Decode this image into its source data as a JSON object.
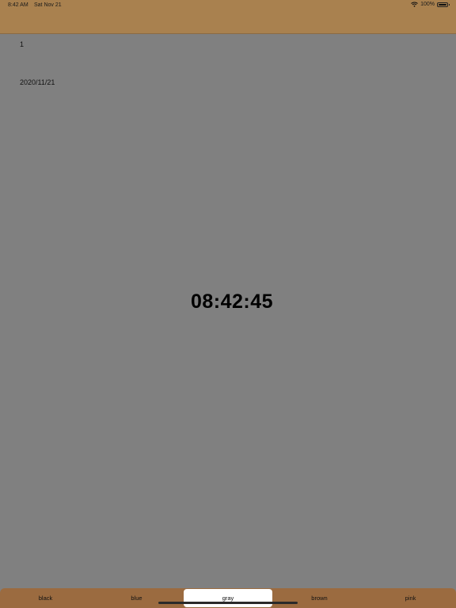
{
  "status_bar": {
    "time": "8:42 AM",
    "date": "Sat Nov 21",
    "battery": "100%"
  },
  "main": {
    "count": "1",
    "date": "2020/11/21",
    "clock": "08:42:45"
  },
  "tabs": [
    {
      "label": "black"
    },
    {
      "label": "blue"
    },
    {
      "label": "gray"
    },
    {
      "label": "brown"
    },
    {
      "label": "pink"
    }
  ],
  "selected_tab": "gray",
  "colors": {
    "nav_bar": "#a9814f",
    "background": "#808080",
    "tab_bar": "#9b6b40",
    "selected_tab": "#ffffff"
  }
}
